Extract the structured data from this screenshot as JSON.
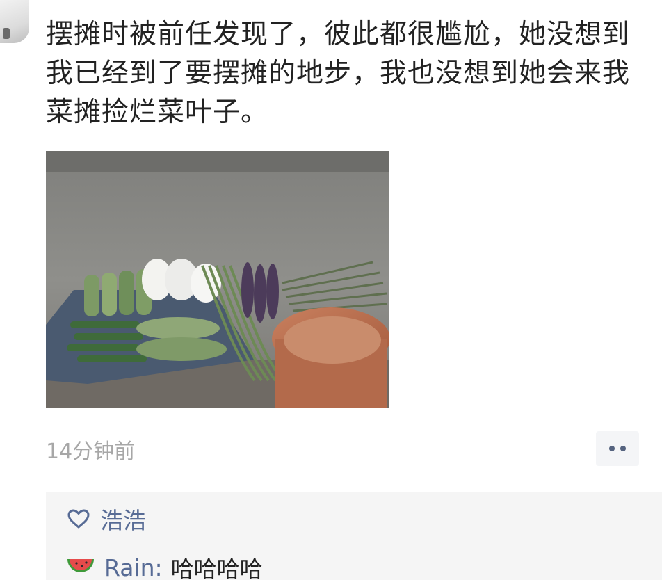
{
  "post": {
    "text": "摆摊时被前任发现了，彼此都很尴尬，她没想到我已经到了要摆摊的地步，我也没想到她会来我菜摊捡烂菜叶子。",
    "timestamp": "14分钟前"
  },
  "likes": {
    "icon": "heart-outline-icon",
    "names": "浩浩"
  },
  "comments": [
    {
      "emoji": "watermelon-icon",
      "author": "Rain:",
      "text": "哈哈哈哈"
    }
  ],
  "colors": {
    "link": "#576b95",
    "text": "#222222",
    "timestamp": "#a7a7a7",
    "panel": "#f5f5f5"
  }
}
